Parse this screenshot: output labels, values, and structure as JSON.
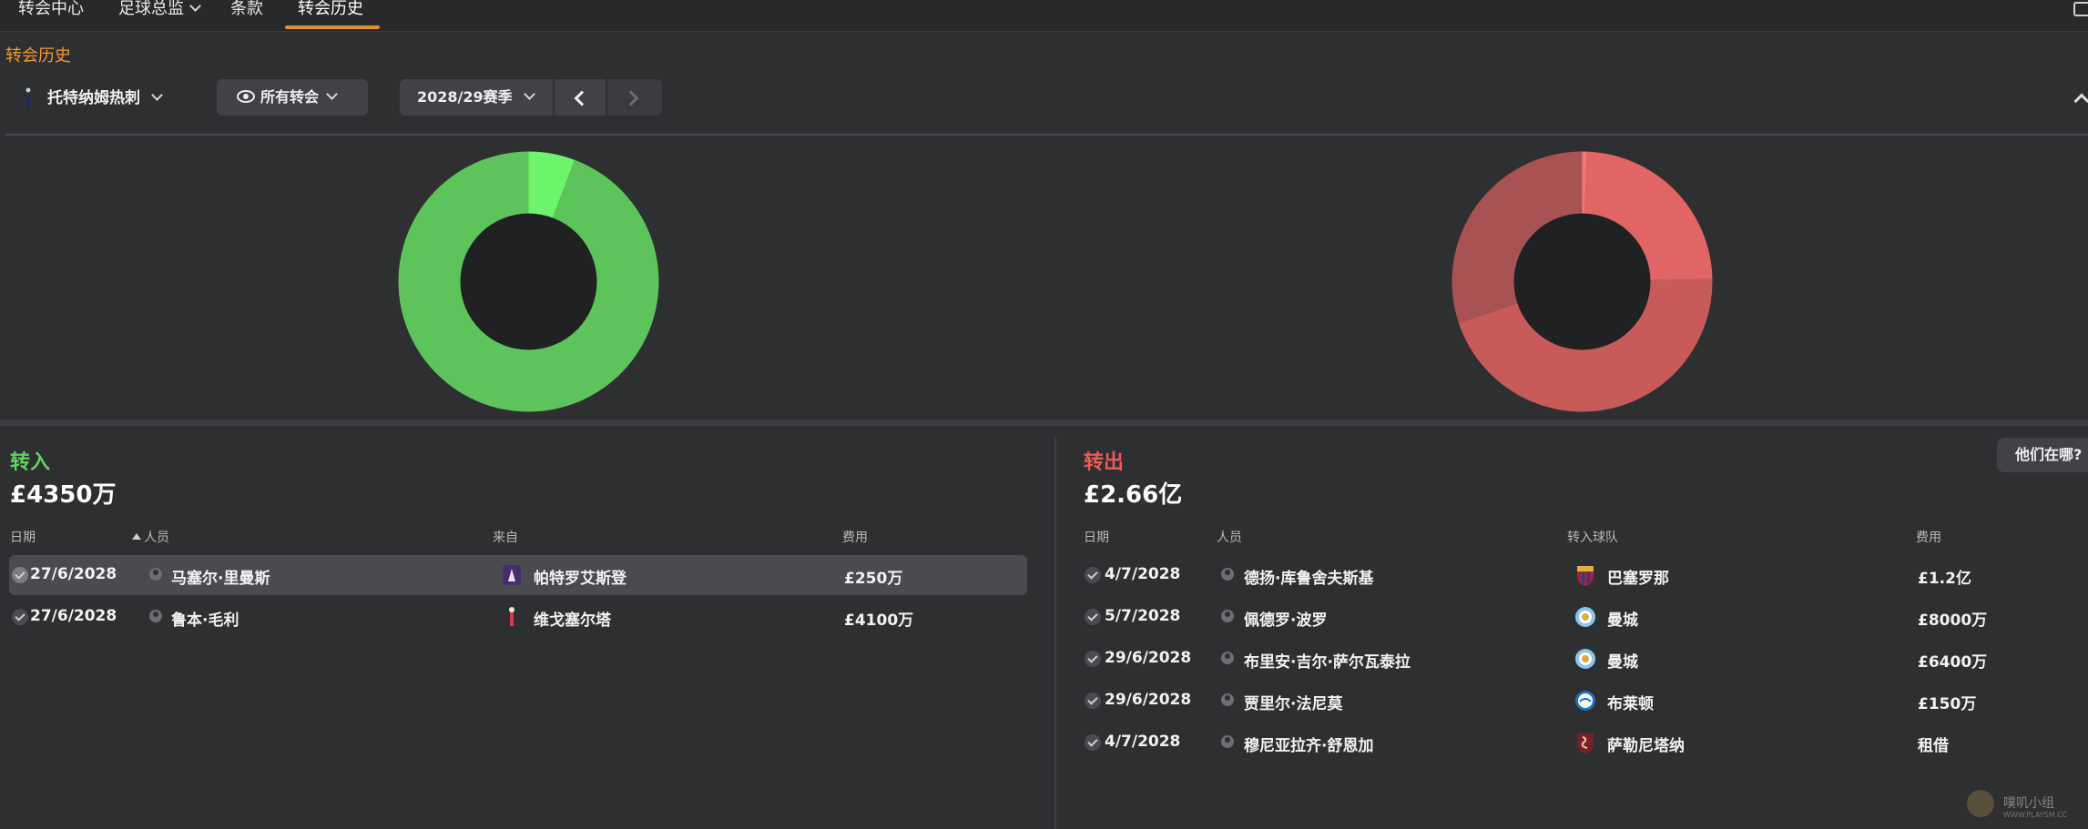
{
  "nav": {
    "tabs": [
      {
        "label": "转会中心"
      },
      {
        "label": "足球总监"
      },
      {
        "label": "条款"
      },
      {
        "label": "转会历史"
      }
    ]
  },
  "page": {
    "title": "转会历史"
  },
  "filters": {
    "club": "托特纳姆热刺",
    "view": "所有转会",
    "season": "2028/29赛季"
  },
  "incoming": {
    "label": "转入",
    "total": "£4350万",
    "headers": {
      "date": "日期",
      "person": "人员",
      "from": "来自",
      "fee": "费用"
    },
    "rows": [
      {
        "date": "27/6/2028",
        "person": "马塞尔·里曼斯",
        "club": "帕特罗艾斯登",
        "fee": "£250万"
      },
      {
        "date": "27/6/2028",
        "person": "鲁本·毛利",
        "club": "维戈塞尔塔",
        "fee": "£4100万"
      }
    ],
    "chart": {
      "slices": [
        {
          "value": 250,
          "color": "#6cf56a"
        },
        {
          "value": 4100,
          "color": "#5cc45a"
        }
      ]
    }
  },
  "outgoing": {
    "label": "转出",
    "total": "£2.66亿",
    "headers": {
      "date": "日期",
      "person": "人员",
      "to": "转入球队",
      "fee": "费用"
    },
    "rows": [
      {
        "date": "4/7/2028",
        "person": "德扬·库鲁舍夫斯基",
        "club": "巴塞罗那",
        "fee": "£1.2亿"
      },
      {
        "date": "5/7/2028",
        "person": "佩德罗·波罗",
        "club": "曼城",
        "fee": "£8000万"
      },
      {
        "date": "29/6/2028",
        "person": "布里安·吉尔·萨尔瓦泰拉",
        "club": "曼城",
        "fee": "£6400万"
      },
      {
        "date": "29/6/2028",
        "person": "贾里尔·法尼莫",
        "club": "布莱顿",
        "fee": "£150万"
      },
      {
        "date": "4/7/2028",
        "person": "穆尼亚拉齐·舒恩加",
        "club": "萨勒尼塔纳",
        "fee": "租借"
      }
    ],
    "chart": {
      "slices": [
        {
          "value": 1.5,
          "color": "#f07a7a"
        },
        {
          "value": 64,
          "color": "#e26565"
        },
        {
          "value": 120,
          "color": "#c85a5a"
        },
        {
          "value": 80,
          "color": "#a95254"
        }
      ]
    }
  },
  "where_button": "他们在哪?",
  "watermark": {
    "text": "噗叽小组",
    "url": "WWW.PLAYSM.CC"
  },
  "colors": {
    "accent": "#ef9b32",
    "in": "#5fd35c",
    "out": "#f05757"
  }
}
